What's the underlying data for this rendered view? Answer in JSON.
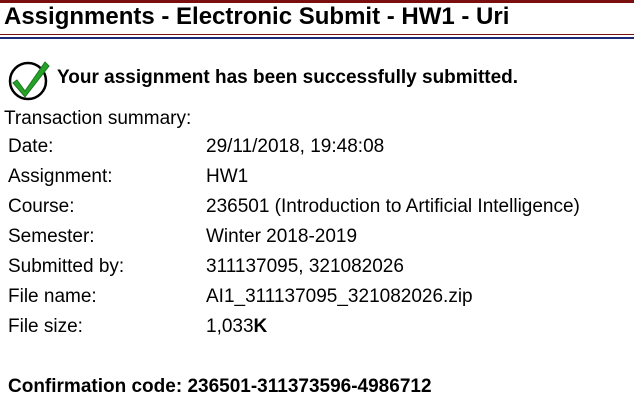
{
  "page": {
    "title": "Assignments - Electronic Submit - HW1 - Uri",
    "success_icon": "check-circle-icon",
    "success_message": "Your assignment has been successfully submitted.",
    "summary_heading": "Transaction summary:"
  },
  "summary": {
    "date": {
      "label": "Date:",
      "value": "29/11/2018, 19:48:08"
    },
    "assignment": {
      "label": "Assignment:",
      "value": "HW1"
    },
    "course": {
      "label": "Course:",
      "value": "236501 (Introduction to Artificial Intelligence)"
    },
    "semester": {
      "label": "Semester:",
      "value": "Winter 2018-2019"
    },
    "submitted_by": {
      "label": "Submitted by:",
      "value": "311137095, 321082026"
    },
    "file_name": {
      "label": "File name:",
      "value": "AI1_311137095_321082026.zip"
    },
    "file_size": {
      "label": "File size:",
      "value": "1,033",
      "unit": "K"
    }
  },
  "confirmation": {
    "text": "Confirmation code: 236501-311373596-4986712"
  },
  "colors": {
    "title_rule_top": "#7a0f0f",
    "title_rule_bottom": "#1c2a78",
    "check_green": "#27a229"
  }
}
